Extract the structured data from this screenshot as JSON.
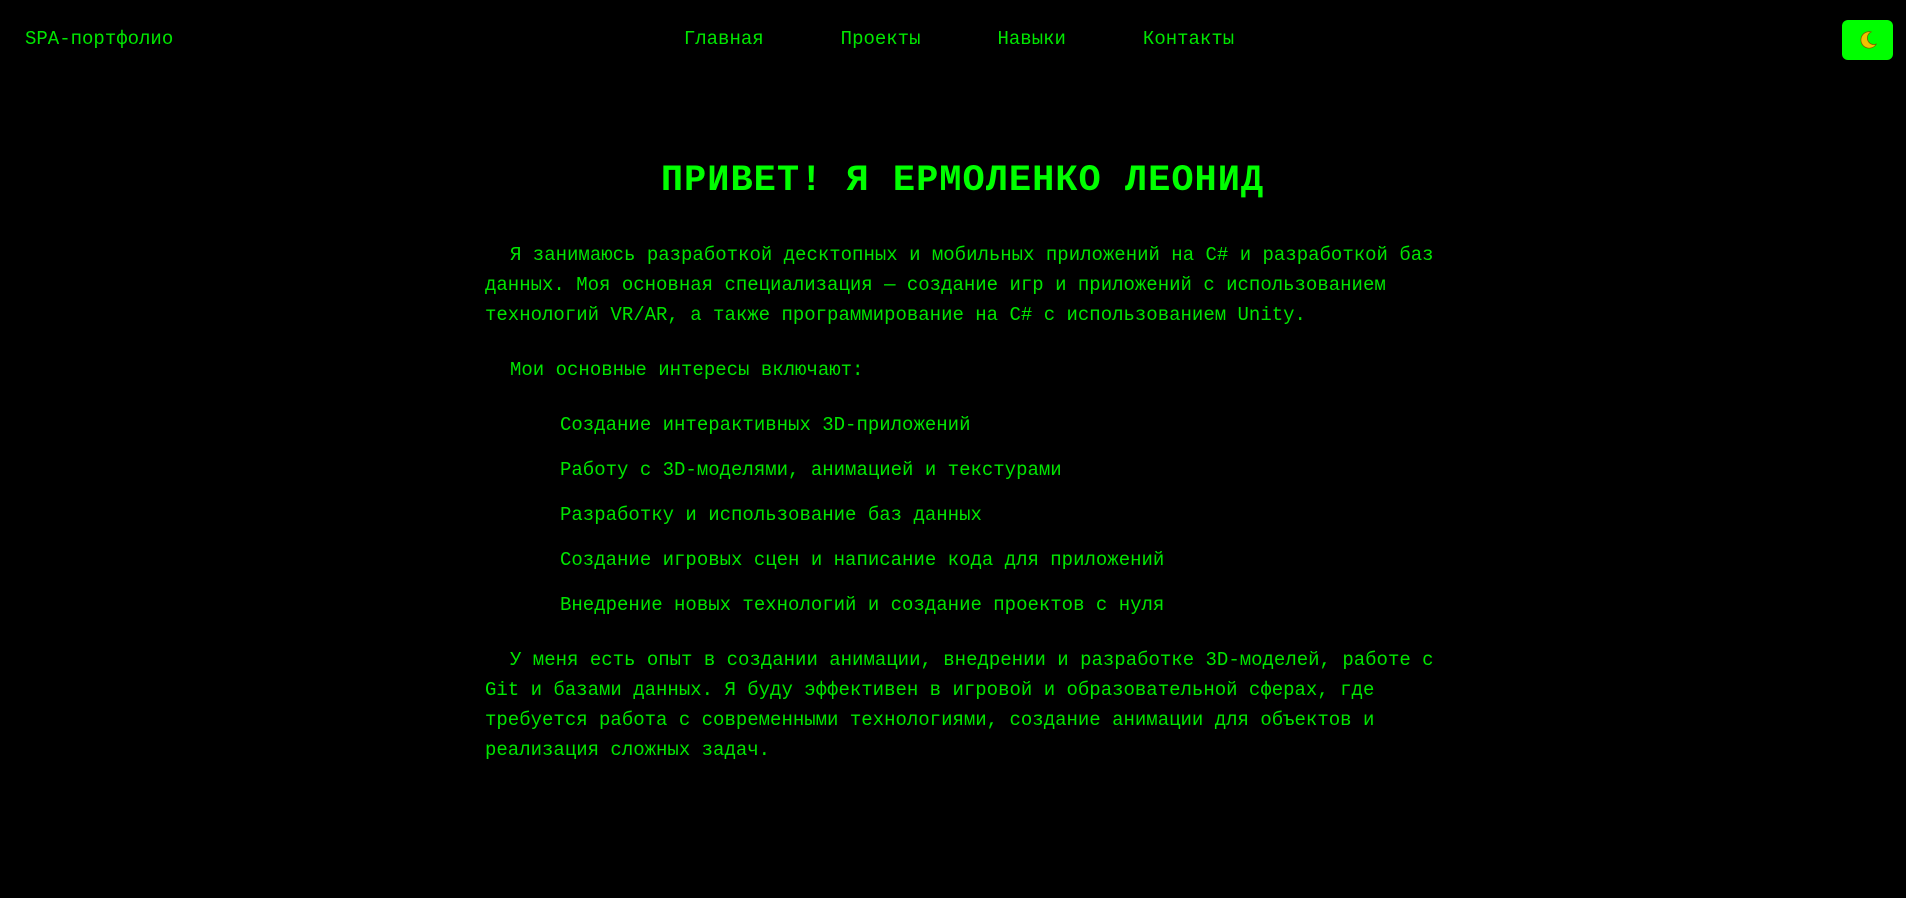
{
  "header": {
    "brand": "SPA-портфолио",
    "nav": [
      {
        "label": "Главная"
      },
      {
        "label": "Проекты"
      },
      {
        "label": "Навыки"
      },
      {
        "label": "Контакты"
      }
    ],
    "theme_toggle_icon": "moon-icon"
  },
  "main": {
    "title": "ПРИВЕТ! Я ЕРМОЛЕНКО ЛЕОНИД",
    "intro": "Я занимаюсь разработкой десктопных и мобильных приложений на C# и разработкой баз данных. Моя основная специализация — создание игр и приложений с использованием технологий VR/AR, а также программирование на C# с использованием Unity.",
    "interests_heading": "Мои основные интересы включают:",
    "interests": [
      "Создание интерактивных 3D-приложений",
      "Работу с 3D-моделями, анимацией и текстурами",
      "Разработку и использование баз данных",
      "Создание игровых сцен и написание кода для приложений",
      "Внедрение новых технологий и создание проектов с нуля"
    ],
    "outro": "У меня есть опыт в создании анимации, внедрении и разработке 3D-моделей, работе с Git и базами данных. Я буду эффективен в игровой и образовательной сферах, где требуется работа с современными технологиями, создание анимации для объектов и реализация сложных задач."
  },
  "colors": {
    "background": "#000000",
    "text": "#00e600",
    "accent": "#00ff00"
  }
}
